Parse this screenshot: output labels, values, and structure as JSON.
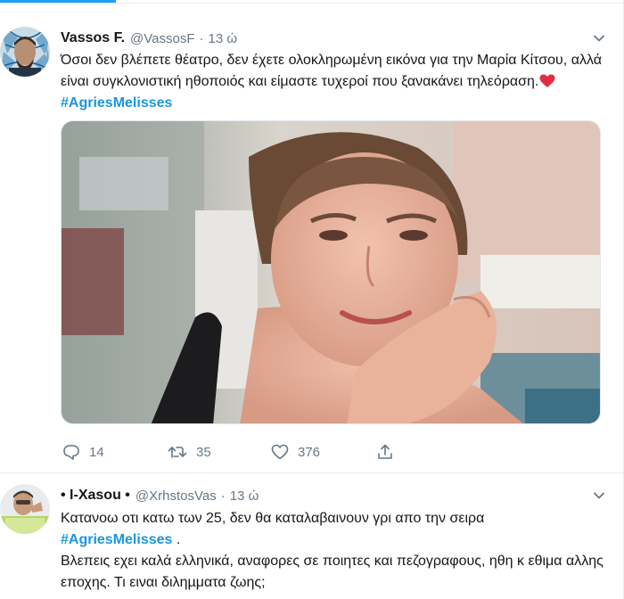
{
  "colors": {
    "accent": "#1da1f2",
    "hashtag": "#1b95e0",
    "heart": "#e0245e",
    "muted": "#657786"
  },
  "tweets": [
    {
      "name": "Vassos F.",
      "handle": "@VassosF",
      "dot": "·",
      "time": "13 ώ",
      "text_main": "Όσοι δεν βλέπετε θέατρο, δεν έχετε ολοκληρωμένη εικόνα για την Μαρία Κίτσου, αλλά είναι συγκλονιστική ηθοποιός και είμαστε τυχεροί που ξανακάνει τηλεόραση.",
      "hashtag": "#AgriesMelisses",
      "icons": {
        "avatar": "avatar-image",
        "chevron": "chevron-down-icon",
        "heart": "heart-emoji-icon"
      },
      "actions": {
        "replies": "14",
        "retweets": "35",
        "likes": "376",
        "icons": [
          "reply-icon",
          "retweet-icon",
          "like-icon",
          "share-icon"
        ]
      }
    },
    {
      "name": "• I-Xasou •",
      "handle": "@XrhstosVas",
      "dot": "·",
      "time": "13 ώ",
      "text_line1": "Κατανοω οτι κατω των 25, δεν θα καταλαβαινουν γρι απο την σειρα",
      "hashtag": "#AgriesMelisses",
      "hashtag_suffix": " .",
      "text_line3": "Βλεπεις εχει καλά ελληνικά, αναφορες σε ποιητες και πεζογραφους, ηθη κ εθιμα αλλης εποχης. Τι ειναι διληµματα ζωης;",
      "icons": {
        "avatar": "avatar-image",
        "chevron": "chevron-down-icon"
      }
    }
  ]
}
